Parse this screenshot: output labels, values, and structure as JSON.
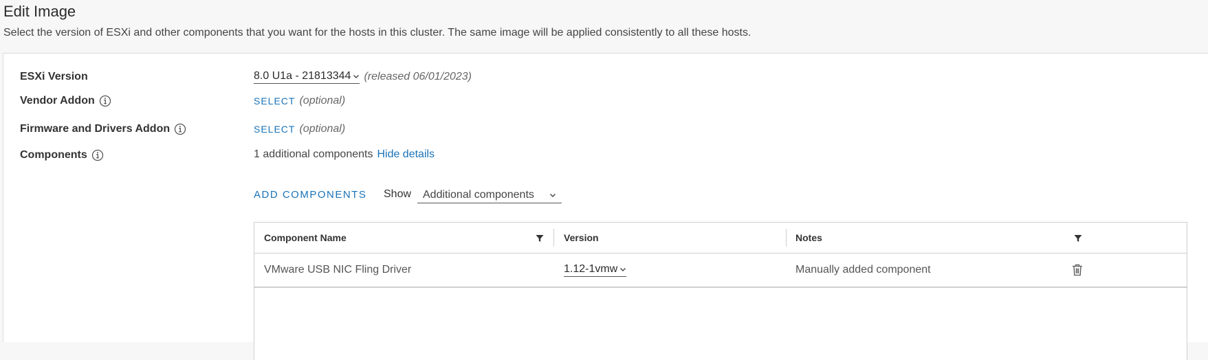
{
  "header": {
    "title": "Edit Image",
    "description": "Select the version of ESXi and other components that you want for the hosts in this cluster. The same image will be applied consistently to all these hosts."
  },
  "form": {
    "esxi": {
      "label": "ESXi Version",
      "value": "8.0 U1a - 21813344",
      "released": "(released 06/01/2023)"
    },
    "vendor_addon": {
      "label": "Vendor Addon",
      "action": "SELECT",
      "hint": "(optional)"
    },
    "firmware_addon": {
      "label": "Firmware and Drivers Addon",
      "action": "SELECT",
      "hint": "(optional)"
    },
    "components": {
      "label": "Components",
      "summary": "1 additional components",
      "toggle": "Hide details"
    }
  },
  "toolbar": {
    "add_label": "ADD COMPONENTS",
    "show_label": "Show",
    "show_value": "Additional components"
  },
  "grid": {
    "columns": [
      "Component Name",
      "Version",
      "Notes"
    ],
    "rows": [
      {
        "name": "VMware USB NIC Fling Driver",
        "version": "1.12-1vmw",
        "notes": "Manually added component"
      }
    ]
  },
  "icons": {
    "info": "info-icon",
    "chevron": "chevron-down-icon",
    "filter": "filter-icon",
    "delete": "trash-icon"
  },
  "colors": {
    "link": "#1a73b8",
    "background": "#f7f7f7"
  }
}
